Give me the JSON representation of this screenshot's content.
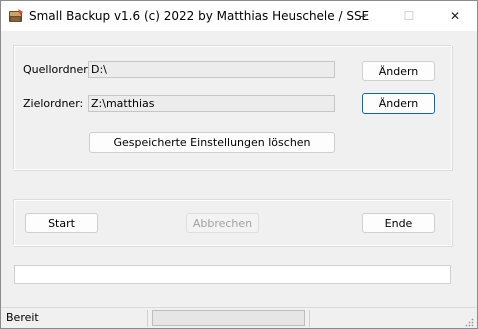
{
  "window": {
    "title": "Small Backup v1.6 (c) 2022 by Matthias Heuschele / SSE",
    "icon": "backup-app-icon",
    "controls": {
      "minimize": "–",
      "maximize": "☐",
      "close": "✕"
    }
  },
  "folders": {
    "source_label": "Quellordner:",
    "source_value": "D:\\",
    "source_button": "Ändern",
    "target_label": "Zielordner:",
    "target_value": "Z:\\matthias",
    "target_button": "Ändern",
    "clear_settings_button": "Gespeicherte Einstellungen löschen"
  },
  "actions": {
    "start": "Start",
    "cancel": "Abbrechen",
    "exit": "Ende"
  },
  "progress": {
    "value": 0
  },
  "statusbar": {
    "text": "Bereit"
  },
  "colors": {
    "focus_border": "#0a66b8",
    "disabled_text": "#a0a0a0",
    "progress_fill": "#06b025"
  }
}
